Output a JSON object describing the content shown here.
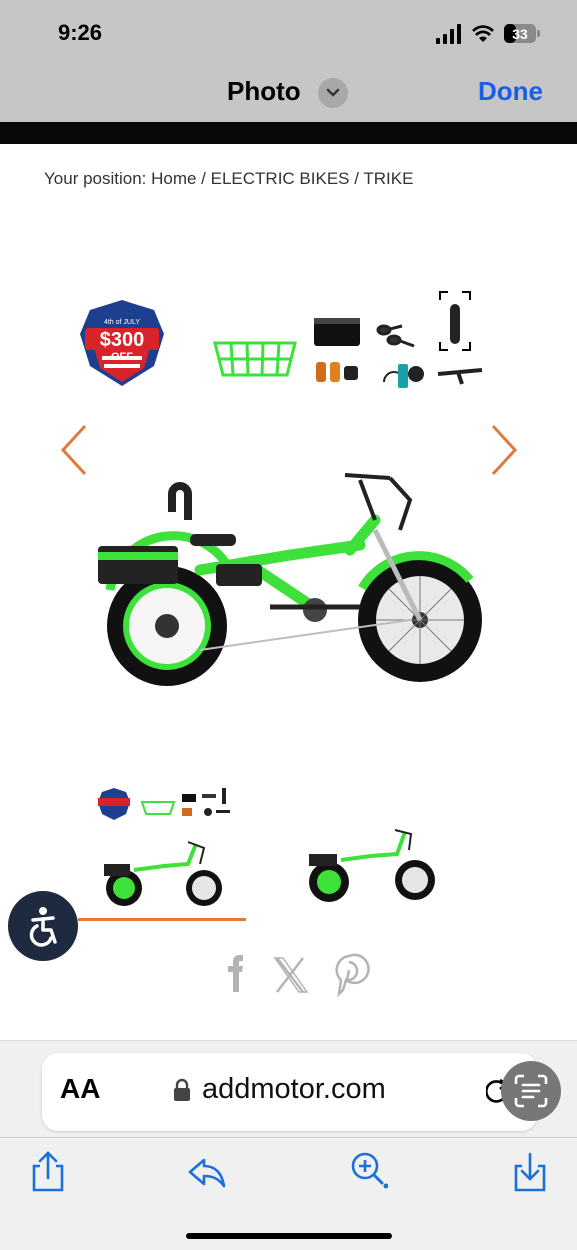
{
  "status_bar": {
    "time": "9:26",
    "battery": "33"
  },
  "photo_header": {
    "title": "Photo",
    "done_label": "Done"
  },
  "page": {
    "breadcrumb": "Your position: Home / ELECTRIC BIKES / TRIKE",
    "promo_badge": {
      "line1": "4th of JULY",
      "amount": "$300",
      "suffix": "OFF"
    }
  },
  "browser": {
    "aa_label": "AA",
    "url": "addmotor.com"
  },
  "colors": {
    "bike_green": "#3ee03a",
    "accent_orange": "#e07a3c",
    "safari_blue": "#1a5ee8",
    "badge_red": "#d8232a",
    "badge_blue": "#1d3f8f"
  },
  "icons": [
    "chevron-down-icon",
    "accessibility-icon",
    "facebook-icon",
    "x-icon",
    "pinterest-icon",
    "lock-icon",
    "reload-icon",
    "live-text-icon",
    "share-icon",
    "reply-icon",
    "zoom-icon",
    "download-icon"
  ]
}
